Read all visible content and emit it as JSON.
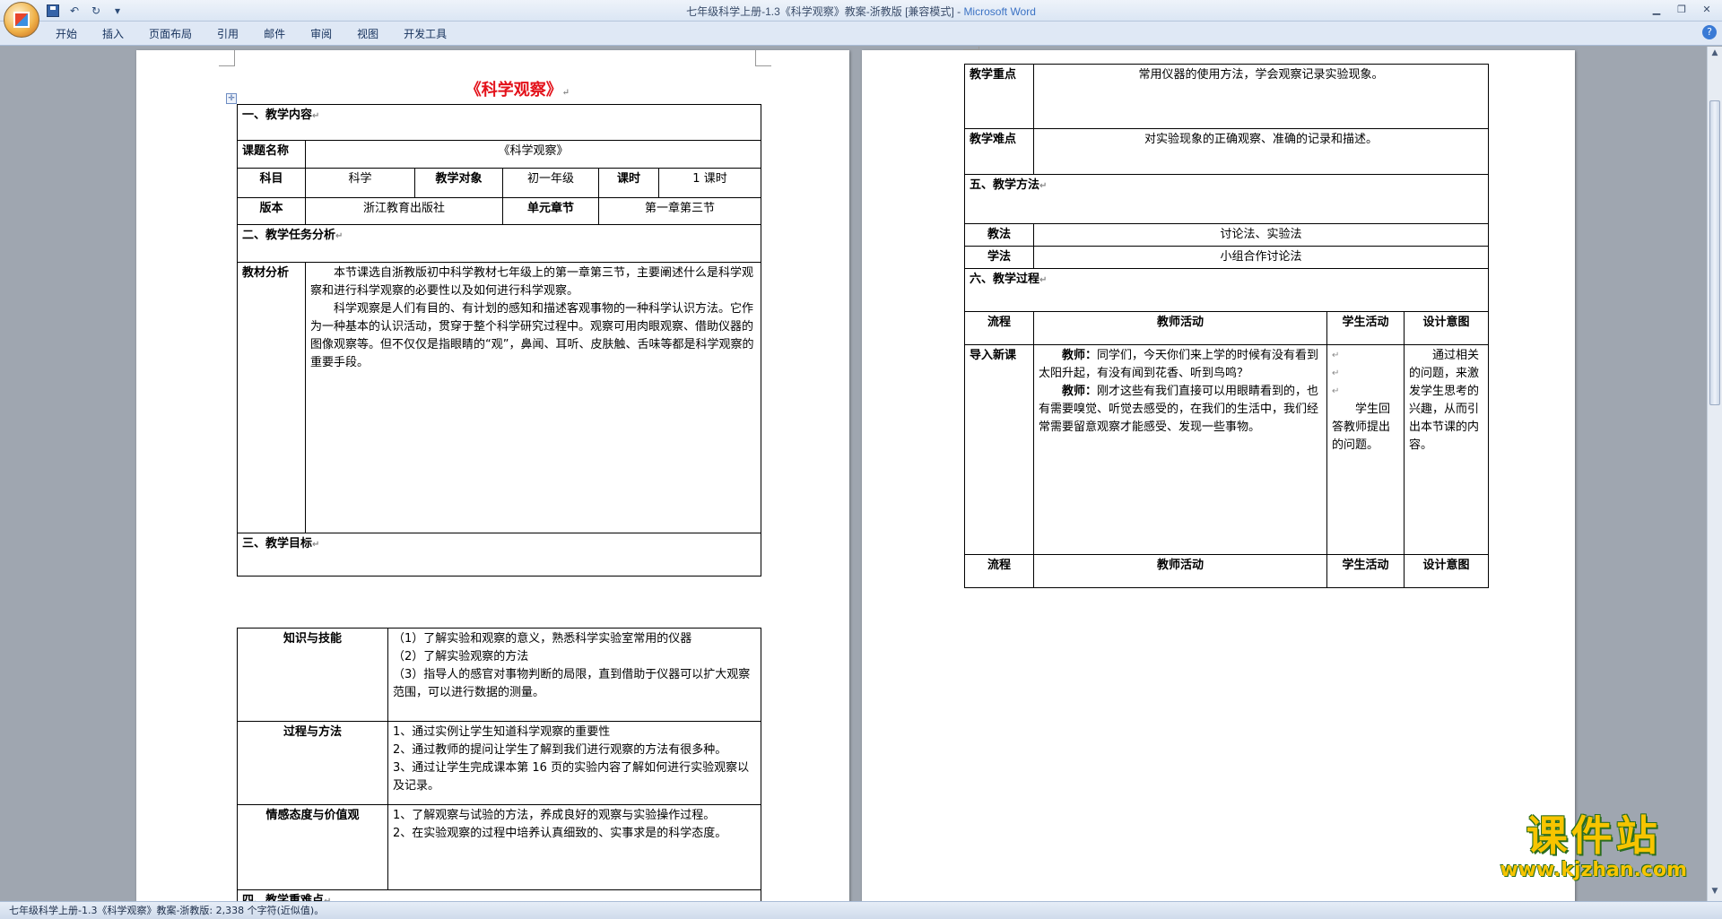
{
  "window": {
    "title": "七年级科学上册-1.3《科学观察》教案-浙教版 [兼容模式] - ",
    "app_name": "Microsoft Word"
  },
  "ribbon": {
    "tabs": [
      "开始",
      "插入",
      "页面布局",
      "引用",
      "邮件",
      "审阅",
      "视图",
      "开发工具"
    ]
  },
  "status_bar": {
    "text": "七年级科学上册-1.3《科学观察》教案-浙教版: 2,338 个字符(近似值)。"
  },
  "watermark": {
    "text": "课件站",
    "url": "www.kjzhan.com"
  },
  "page1": {
    "title": "《科学观察》",
    "sec1": "一、教学内容",
    "course_name_label": "课题名称",
    "course_name_value": "《科学观察》",
    "subject_label": "科目",
    "subject_value": "科学",
    "audience_label": "教学对象",
    "audience_value": "初一年级",
    "hours_label": "课时",
    "hours_value": "1 课时",
    "edition_label": "版本",
    "edition_value": "浙江教育出版社",
    "chapter_label": "单元章节",
    "chapter_value": "第一章第三节",
    "sec2": "二、教学任务分析",
    "analysis_label": "教材分析",
    "analysis_p1": "本节课选自浙教版初中科学教材七年级上的第一章第三节，主要阐述什么是科学观察和进行科学观察的必要性以及如何进行科学观察。",
    "analysis_p2": "科学观察是人们有目的、有计划的感知和描述客观事物的一种科学认识方法。它作为一种基本的认识活动，贯穿于整个科学研究过程中。观察可用肉眼观察、借助仪器的图像观察等。但不仅仅是指眼睛的“观”，鼻闻、耳听、皮肤触、舌味等都是科学观察的重要手段。",
    "sec3": "三、教学目标",
    "knowledge_label": "知识与技能",
    "knowledge_items": [
      "（1）了解实验和观察的意义，熟悉科学实验室常用的仪器",
      "（2）了解实验观察的方法",
      "（3）指导人的感官对事物判断的局限，直到借助于仪器可以扩大观察范围，可以进行数据的测量。"
    ],
    "process_label": "过程与方法",
    "process_items": [
      "1、通过实例让学生知道科学观察的重要性",
      "2、通过教师的提问让学生了解到我们进行观察的方法有很多种。",
      "3、通过让学生完成课本第 16 页的实验内容了解如何进行实验观察以及记录。"
    ],
    "attitude_label": "情感态度与价值观",
    "attitude_items": [
      "1、了解观察与试验的方法，养成良好的观察与实验操作过程。",
      "2、在实验观察的过程中培养认真细致的、实事求是的科学态度。"
    ],
    "sec4": "四、教学重难点"
  },
  "page2": {
    "key_label": "教学重点",
    "key_value": "常用仪器的使用方法，学会观察记录实验现象。",
    "difficulty_label": "教学难点",
    "difficulty_value": "对实验现象的正确观察、准确的记录和描述。",
    "sec5": "五、教学方法",
    "teach_method_label": "教法",
    "teach_method_value": "讨论法、实验法",
    "learn_method_label": "学法",
    "learn_method_value": "小组合作讨论法",
    "sec6": "六、教学过程",
    "header_flow": "流程",
    "header_teacher": "教师活动",
    "header_student": "学生活动",
    "header_design": "设计意图",
    "intro_label": "导入新课",
    "teacher_tag1": "教师：",
    "teacher_text1": "同学们，今天你们来上学的时候有没有看到太阳升起，有没有闻到花香、听到鸟鸣？",
    "teacher_tag2": "教师：",
    "teacher_text2": "刚才这些有我们直接可以用眼睛看到的，也有需要嗅觉、听觉去感受的，在我们的生活中，我们经常需要留意观察才能感受、发现一些事物。",
    "student_text": "学生回答教师提出的问题。",
    "design_text": "通过相关的问题，来激发学生思考的兴趣，从而引出本节课的内容。"
  }
}
